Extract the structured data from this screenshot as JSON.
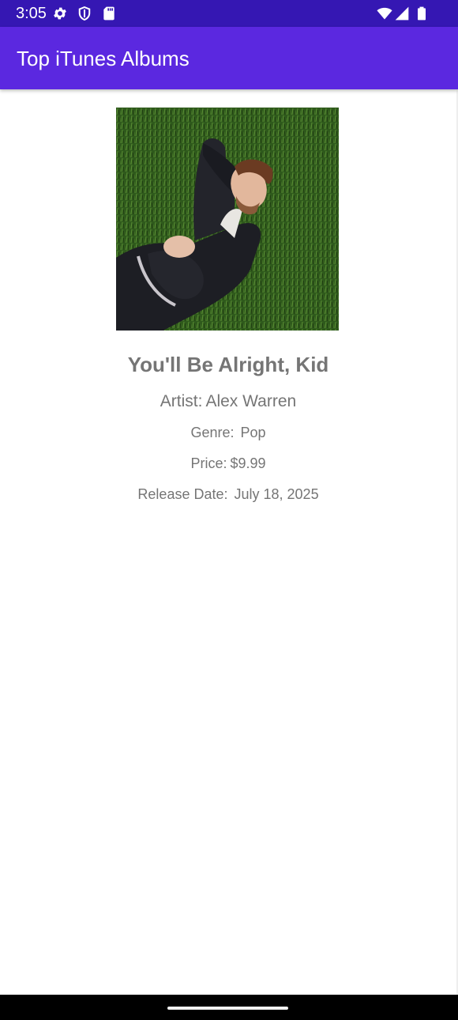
{
  "status_bar": {
    "time": "3:05",
    "icons": [
      "gear-icon",
      "shield-icon",
      "sd-card-icon",
      "wifi-icon",
      "cell-signal-icon",
      "battery-icon"
    ],
    "background_color": "#3517b3"
  },
  "app_bar": {
    "title": "Top iTunes Albums",
    "background_color": "#5b28e0"
  },
  "album": {
    "cover_description_icon": "album-cover-image",
    "title": "You'll Be Alright, Kid",
    "artist_label": "Artist:",
    "artist": "Alex Warren",
    "genre_label": "Genre:",
    "genre": "Pop",
    "price_label": "Price:",
    "price": "$9.99",
    "release_date_label": "Release Date:",
    "release_date": "July 18, 2025",
    "text_color": "#757575"
  }
}
